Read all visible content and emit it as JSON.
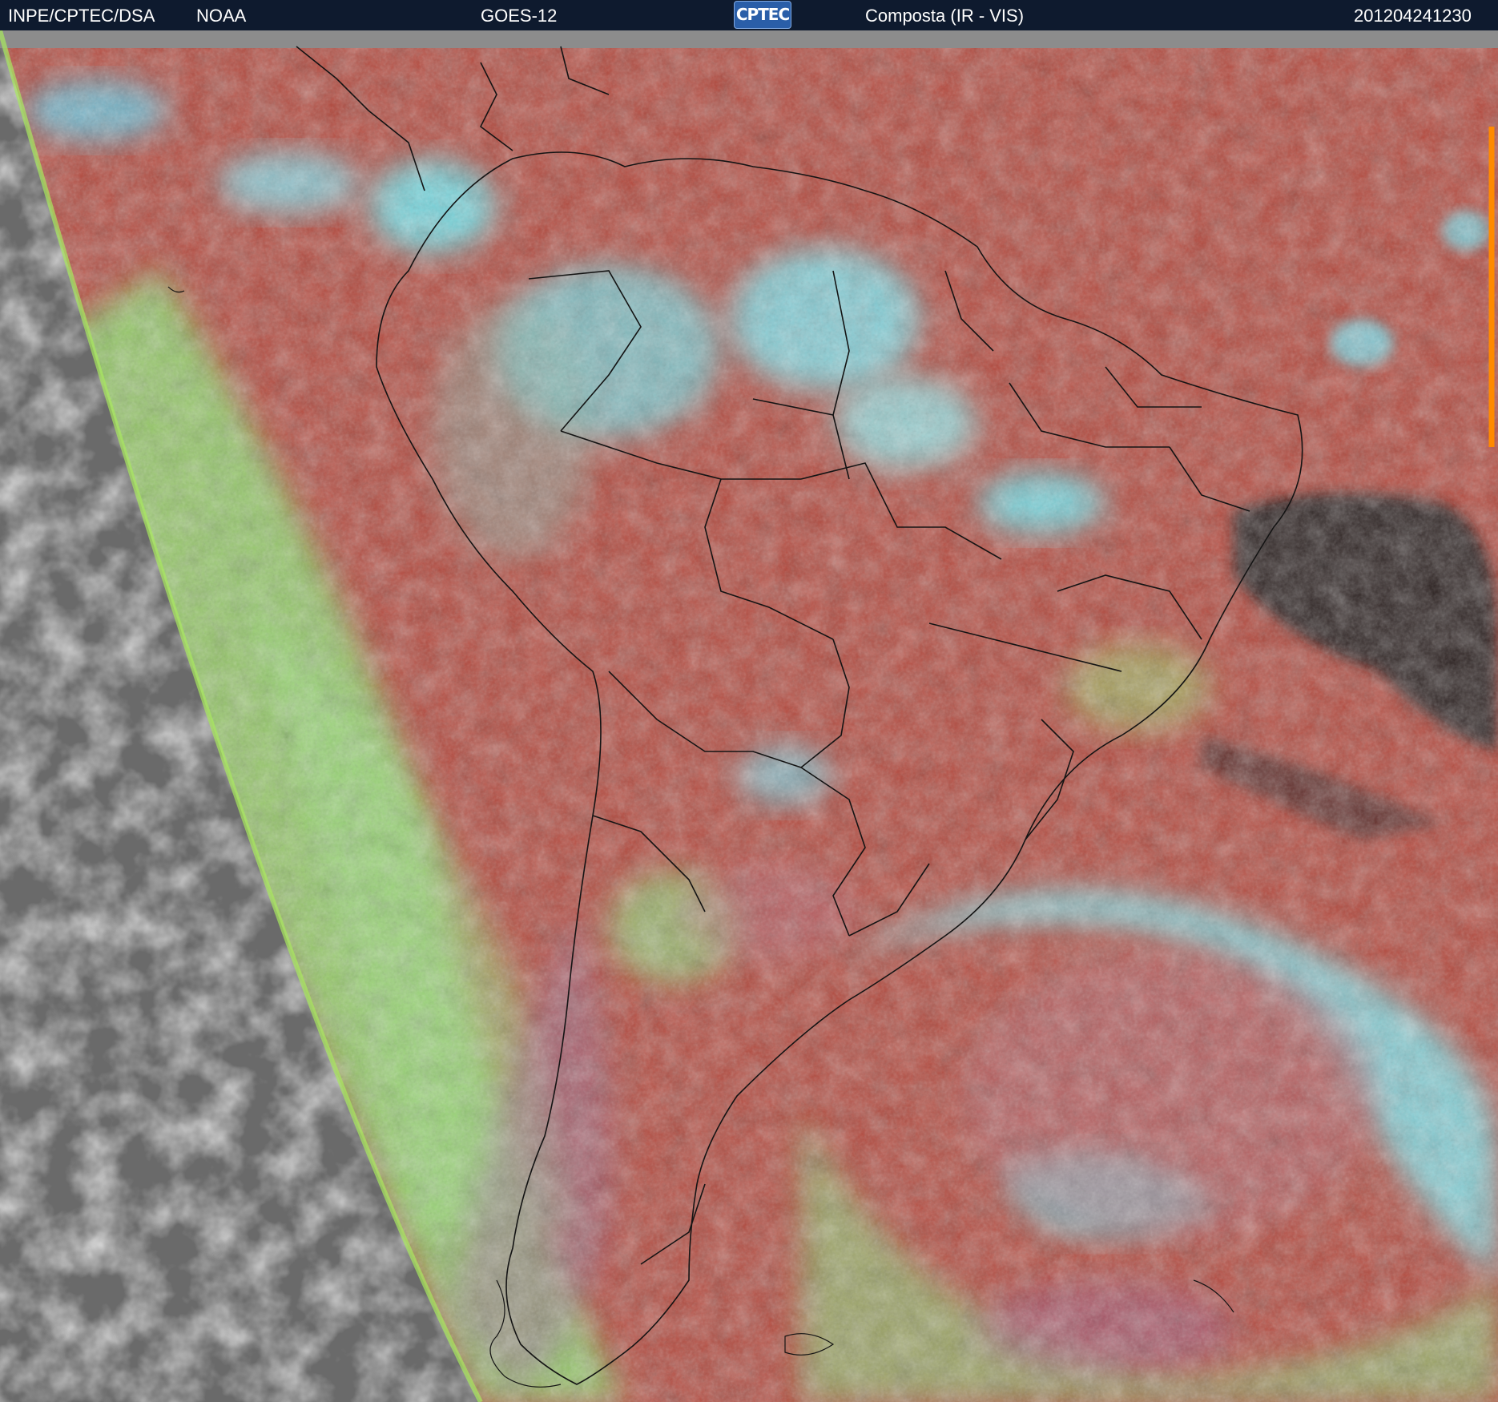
{
  "header": {
    "source": "INPE/CPTEC/DSA",
    "agency": "NOAA",
    "satellite": "GOES-12",
    "logo_text": "CPTEC",
    "product": "Composta (IR - VIS)",
    "timestamp": "201204241230"
  },
  "colors": {
    "header_bg": "#0e1a2e",
    "space_gray": "#7d7d7d",
    "ir_warm": "#b34438",
    "cloud_cyan": "#6ae6f0",
    "cloud_green": "#8fe06a",
    "deep_dry": "#1a1414"
  }
}
